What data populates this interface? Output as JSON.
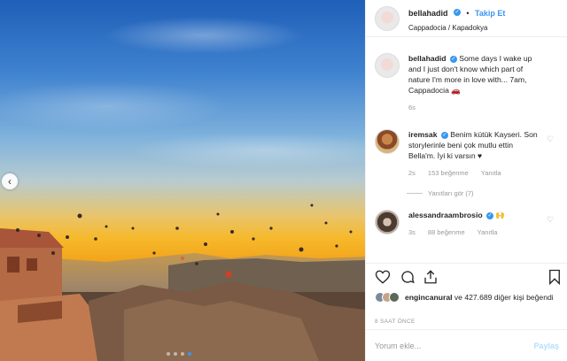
{
  "header": {
    "username": "bellahadid",
    "verified_icon": "verified-badge-icon",
    "separator": "•",
    "follow_label": "Takip Et",
    "location": "Cappadocia / Kapadokya"
  },
  "caption": {
    "username": "bellahadid",
    "text": "Some days I wake up and I just don't know which part of nature I'm more in love with... 7am, Cappadocia 🚗",
    "time": "6s"
  },
  "comments": [
    {
      "username": "iremsak",
      "text": "Benim kütük Kayseri. Son storylerinle beni çok mutlu ettin Bella'm. İyi ki varsın ♥",
      "time": "2s",
      "likes": "153 beğenme",
      "reply": "Yanıtla",
      "view_replies": "Yanıtları gör (7)"
    },
    {
      "username": "alessandraambrosio",
      "text": "🙌",
      "time": "3s",
      "likes": "88 beğenme",
      "reply": "Yanıtla"
    }
  ],
  "likes_summary": {
    "first_user": "engincanural",
    "rest": "ve 427.689 diğer kişi beğendi"
  },
  "posted_ago": "8 SAAT ÖNCE",
  "comment_input": {
    "placeholder": "Yorum ekle...",
    "post_label": "Paylaş"
  },
  "carousel": {
    "total": 4,
    "active_index": 3
  },
  "colors": {
    "accent": "#3897f0",
    "muted": "#999999",
    "post_disabled": "#b2dffc"
  }
}
